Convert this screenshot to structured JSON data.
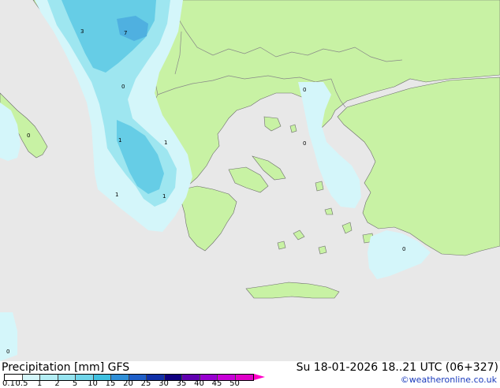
{
  "product": "Precipitation [mm]",
  "model": "GFS",
  "valid_time": "Su 18-01-2026 18..21 UTC (06+327)",
  "credit": "©weatheronline.co.uk",
  "colors": {
    "sea": "#e8e8e8",
    "land": "#c8f2a4",
    "border": "#888888",
    "coast": "#6b6b6b",
    "precip_light": "#d4f6fa",
    "precip_medium": "#9ee6f0",
    "precip_heavy": "#66cde6",
    "precip_max": "#4fb0e0"
  },
  "legend": {
    "ticks": [
      "0.1",
      "0.5",
      "1",
      "2",
      "5",
      "10",
      "15",
      "20",
      "25",
      "30",
      "35",
      "40",
      "45",
      "50"
    ],
    "colors": [
      "#ffffff",
      "#d4f6fa",
      "#b4eef5",
      "#96e4f0",
      "#6fd5ea",
      "#3fc0e0",
      "#2f8fd8",
      "#1f5fc8",
      "#1030a8",
      "#100080",
      "#6000b0",
      "#9800d0",
      "#c800d8",
      "#e000c8"
    ],
    "arrow_color": "#ff00c8"
  },
  "value_labels": [
    "3",
    "7",
    "0",
    "0",
    "0",
    "0",
    "1",
    "1",
    "1",
    "1",
    "0",
    "0"
  ]
}
